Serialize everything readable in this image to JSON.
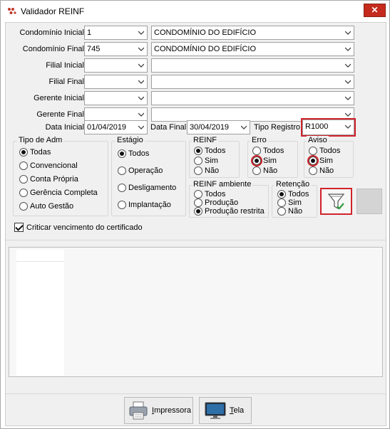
{
  "window": {
    "title": "Validador REINF",
    "close_glyph": "✕"
  },
  "filters": {
    "condominio_inicial": {
      "label": "Condomínio Inicial",
      "code": "1",
      "name": "CONDOMÍNIO DO EDIFÍCIO"
    },
    "condominio_final": {
      "label": "Condomínio Final",
      "code": "745",
      "name": "CONDOMÍNIO DO EDIFÍCIO"
    },
    "filial_inicial": {
      "label": "Filial Inicial",
      "code": "",
      "name": ""
    },
    "filial_final": {
      "label": "Filial Final",
      "code": "",
      "name": ""
    },
    "gerente_inicial": {
      "label": "Gerente Inicial",
      "code": "",
      "name": ""
    },
    "gerente_final": {
      "label": "Gerente Final",
      "code": "",
      "name": ""
    },
    "data_inicial": {
      "label": "Data Inicial",
      "value": "01/04/2019"
    },
    "data_final": {
      "label": "Data Final",
      "value": "30/04/2019"
    },
    "tipo_registro": {
      "label": "Tipo Registro",
      "value": "R1000"
    }
  },
  "groups": {
    "tipo_adm": {
      "title": "Tipo de Adm",
      "options": [
        "Todas",
        "Convencional",
        "Conta Própria",
        "Gerência Completa",
        "Auto Gestão"
      ],
      "selected": 0
    },
    "estagio": {
      "title": "Estágio",
      "options": [
        "Todos",
        "Operação",
        "Desligamento",
        "Implantação"
      ],
      "selected": 0
    },
    "reinf": {
      "title": "REINF",
      "options": [
        "Todos",
        "Sim",
        "Não"
      ],
      "selected": 0
    },
    "erro": {
      "title": "Erro",
      "options": [
        "Todos",
        "Sim",
        "Não"
      ],
      "selected": 1
    },
    "aviso": {
      "title": "Aviso",
      "options": [
        "Todos",
        "Sim",
        "Não"
      ],
      "selected": 1
    },
    "reinf_ambiente": {
      "title": "REINF ambiente",
      "options": [
        "Todos",
        "Produção",
        "Produção restrita"
      ],
      "selected": 2
    },
    "retencao": {
      "title": "Retenção",
      "options": [
        "Todos",
        "Sim",
        "Não"
      ],
      "selected": 0
    }
  },
  "criticar": {
    "label": "Criticar vencimento do certificado",
    "checked": true
  },
  "buttons": {
    "impressora": {
      "accel": "I",
      "rest": "mpressora"
    },
    "tela": {
      "accel": "T",
      "rest": "ela"
    }
  },
  "icons": {
    "app": "reinf-logo-icon",
    "filter": "filter-check-icon",
    "printer": "printer-icon",
    "monitor": "monitor-icon"
  },
  "colors": {
    "highlight": "#d0232a",
    "close": "#c42b1c"
  }
}
